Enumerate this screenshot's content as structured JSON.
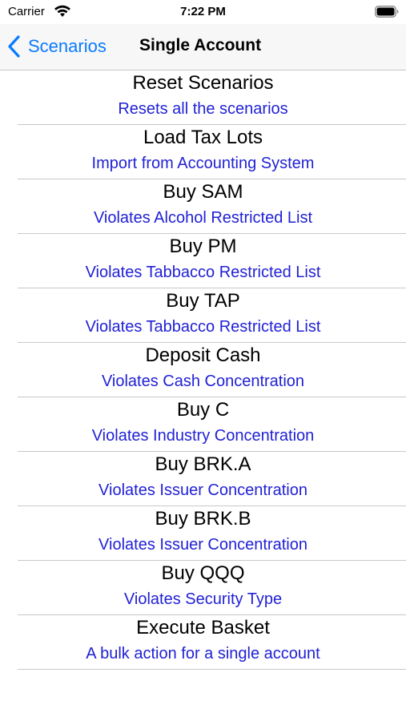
{
  "status_bar": {
    "carrier": "Carrier",
    "time": "7:22 PM",
    "icons": [
      "wifi-icon",
      "battery-icon"
    ]
  },
  "nav": {
    "back_label": "Scenarios",
    "title": "Single Account",
    "back_icon": "chevron-left-icon"
  },
  "colors": {
    "accent": "#0a7aff",
    "subtitle": "#2121d6",
    "separator": "#c8c7cc"
  },
  "scenarios": [
    {
      "title": "Reset Scenarios",
      "subtitle": "Resets all the scenarios"
    },
    {
      "title": "Load Tax Lots",
      "subtitle": "Import from Accounting System"
    },
    {
      "title": "Buy SAM",
      "subtitle": "Violates Alcohol Restricted List"
    },
    {
      "title": "Buy PM",
      "subtitle": "Violates Tabbacco Restricted List"
    },
    {
      "title": "Buy TAP",
      "subtitle": "Violates Tabbacco Restricted List"
    },
    {
      "title": "Deposit Cash",
      "subtitle": "Violates Cash Concentration"
    },
    {
      "title": "Buy C",
      "subtitle": "Violates Industry Concentration"
    },
    {
      "title": "Buy BRK.A",
      "subtitle": "Violates Issuer Concentration"
    },
    {
      "title": "Buy BRK.B",
      "subtitle": "Violates Issuer Concentration"
    },
    {
      "title": "Buy QQQ",
      "subtitle": "Violates Security Type"
    },
    {
      "title": "Execute Basket",
      "subtitle": "A bulk action for a single account"
    }
  ]
}
